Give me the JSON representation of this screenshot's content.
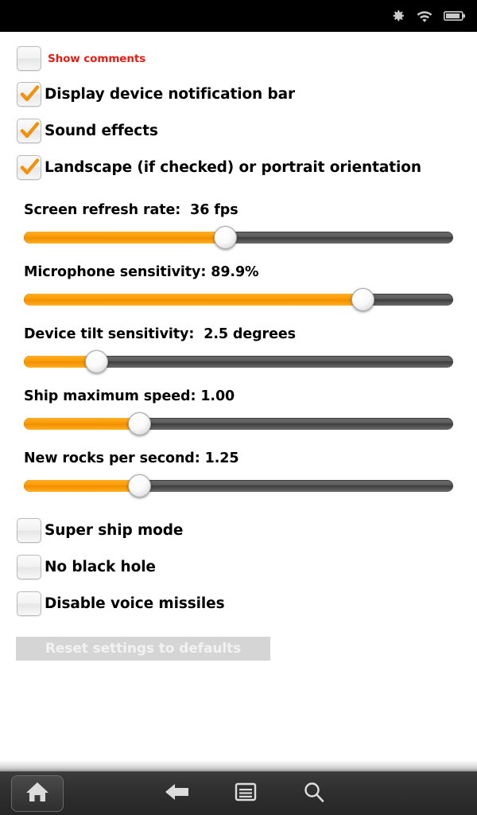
{
  "status_bar": {
    "icons": [
      {
        "name": "settings-gear-icon",
        "label": "gear-icon"
      },
      {
        "name": "wifi-icon",
        "label": "wifi-icon"
      },
      {
        "name": "battery-icon",
        "label": "battery-icon"
      }
    ],
    "background_color": "#000000"
  },
  "theme": {
    "accent_orange": "#fb9c04",
    "track_gray": "#4d4d4d",
    "link_red": "#e81c12",
    "button_disabled_bg": "#d5d5d5",
    "button_disabled_text": "#f2f2f2"
  },
  "settings": {
    "checkboxes_top": [
      {
        "id": "show-comments",
        "label": "Show comments",
        "checked": false,
        "style": "small-red"
      },
      {
        "id": "display-notification-bar",
        "label": "Display device notification bar",
        "checked": true,
        "style": "normal"
      },
      {
        "id": "sound-effects",
        "label": "Sound effects",
        "checked": true,
        "style": "normal"
      },
      {
        "id": "landscape-orientation",
        "label": "Landscape (if checked) or portrait orientation",
        "checked": true,
        "style": "normal"
      }
    ],
    "sliders": [
      {
        "id": "screen-refresh-rate",
        "label": "Screen refresh rate:  36 fps",
        "value": 36,
        "unit": "fps",
        "percent": 47
      },
      {
        "id": "microphone-sensitivity",
        "label": "Microphone sensitivity: 89.9%",
        "value": 89.9,
        "unit": "%",
        "percent": 79
      },
      {
        "id": "device-tilt-sensitivity",
        "label": "Device tilt sensitivity:  2.5 degrees",
        "value": 2.5,
        "unit": "degrees",
        "percent": 17
      },
      {
        "id": "ship-maximum-speed",
        "label": "Ship maximum speed: 1.00",
        "value": 1.0,
        "unit": "",
        "percent": 27
      },
      {
        "id": "new-rocks-per-second",
        "label": "New rocks per second: 1.25",
        "value": 1.25,
        "unit": "",
        "percent": 27
      }
    ],
    "checkboxes_bottom": [
      {
        "id": "super-ship-mode",
        "label": "Super ship mode",
        "checked": false,
        "style": "normal"
      },
      {
        "id": "no-black-hole",
        "label": "No black hole",
        "checked": false,
        "style": "normal"
      },
      {
        "id": "disable-voice-missiles",
        "label": "Disable voice missiles",
        "checked": false,
        "style": "normal"
      }
    ],
    "reset_button": {
      "label": "Reset settings to defaults",
      "enabled": false
    }
  },
  "nav_bar": {
    "buttons": [
      {
        "id": "home",
        "icon": "home-icon"
      },
      {
        "id": "back",
        "icon": "back-arrow-icon"
      },
      {
        "id": "menu",
        "icon": "menu-icon"
      },
      {
        "id": "search",
        "icon": "search-icon"
      }
    ]
  }
}
